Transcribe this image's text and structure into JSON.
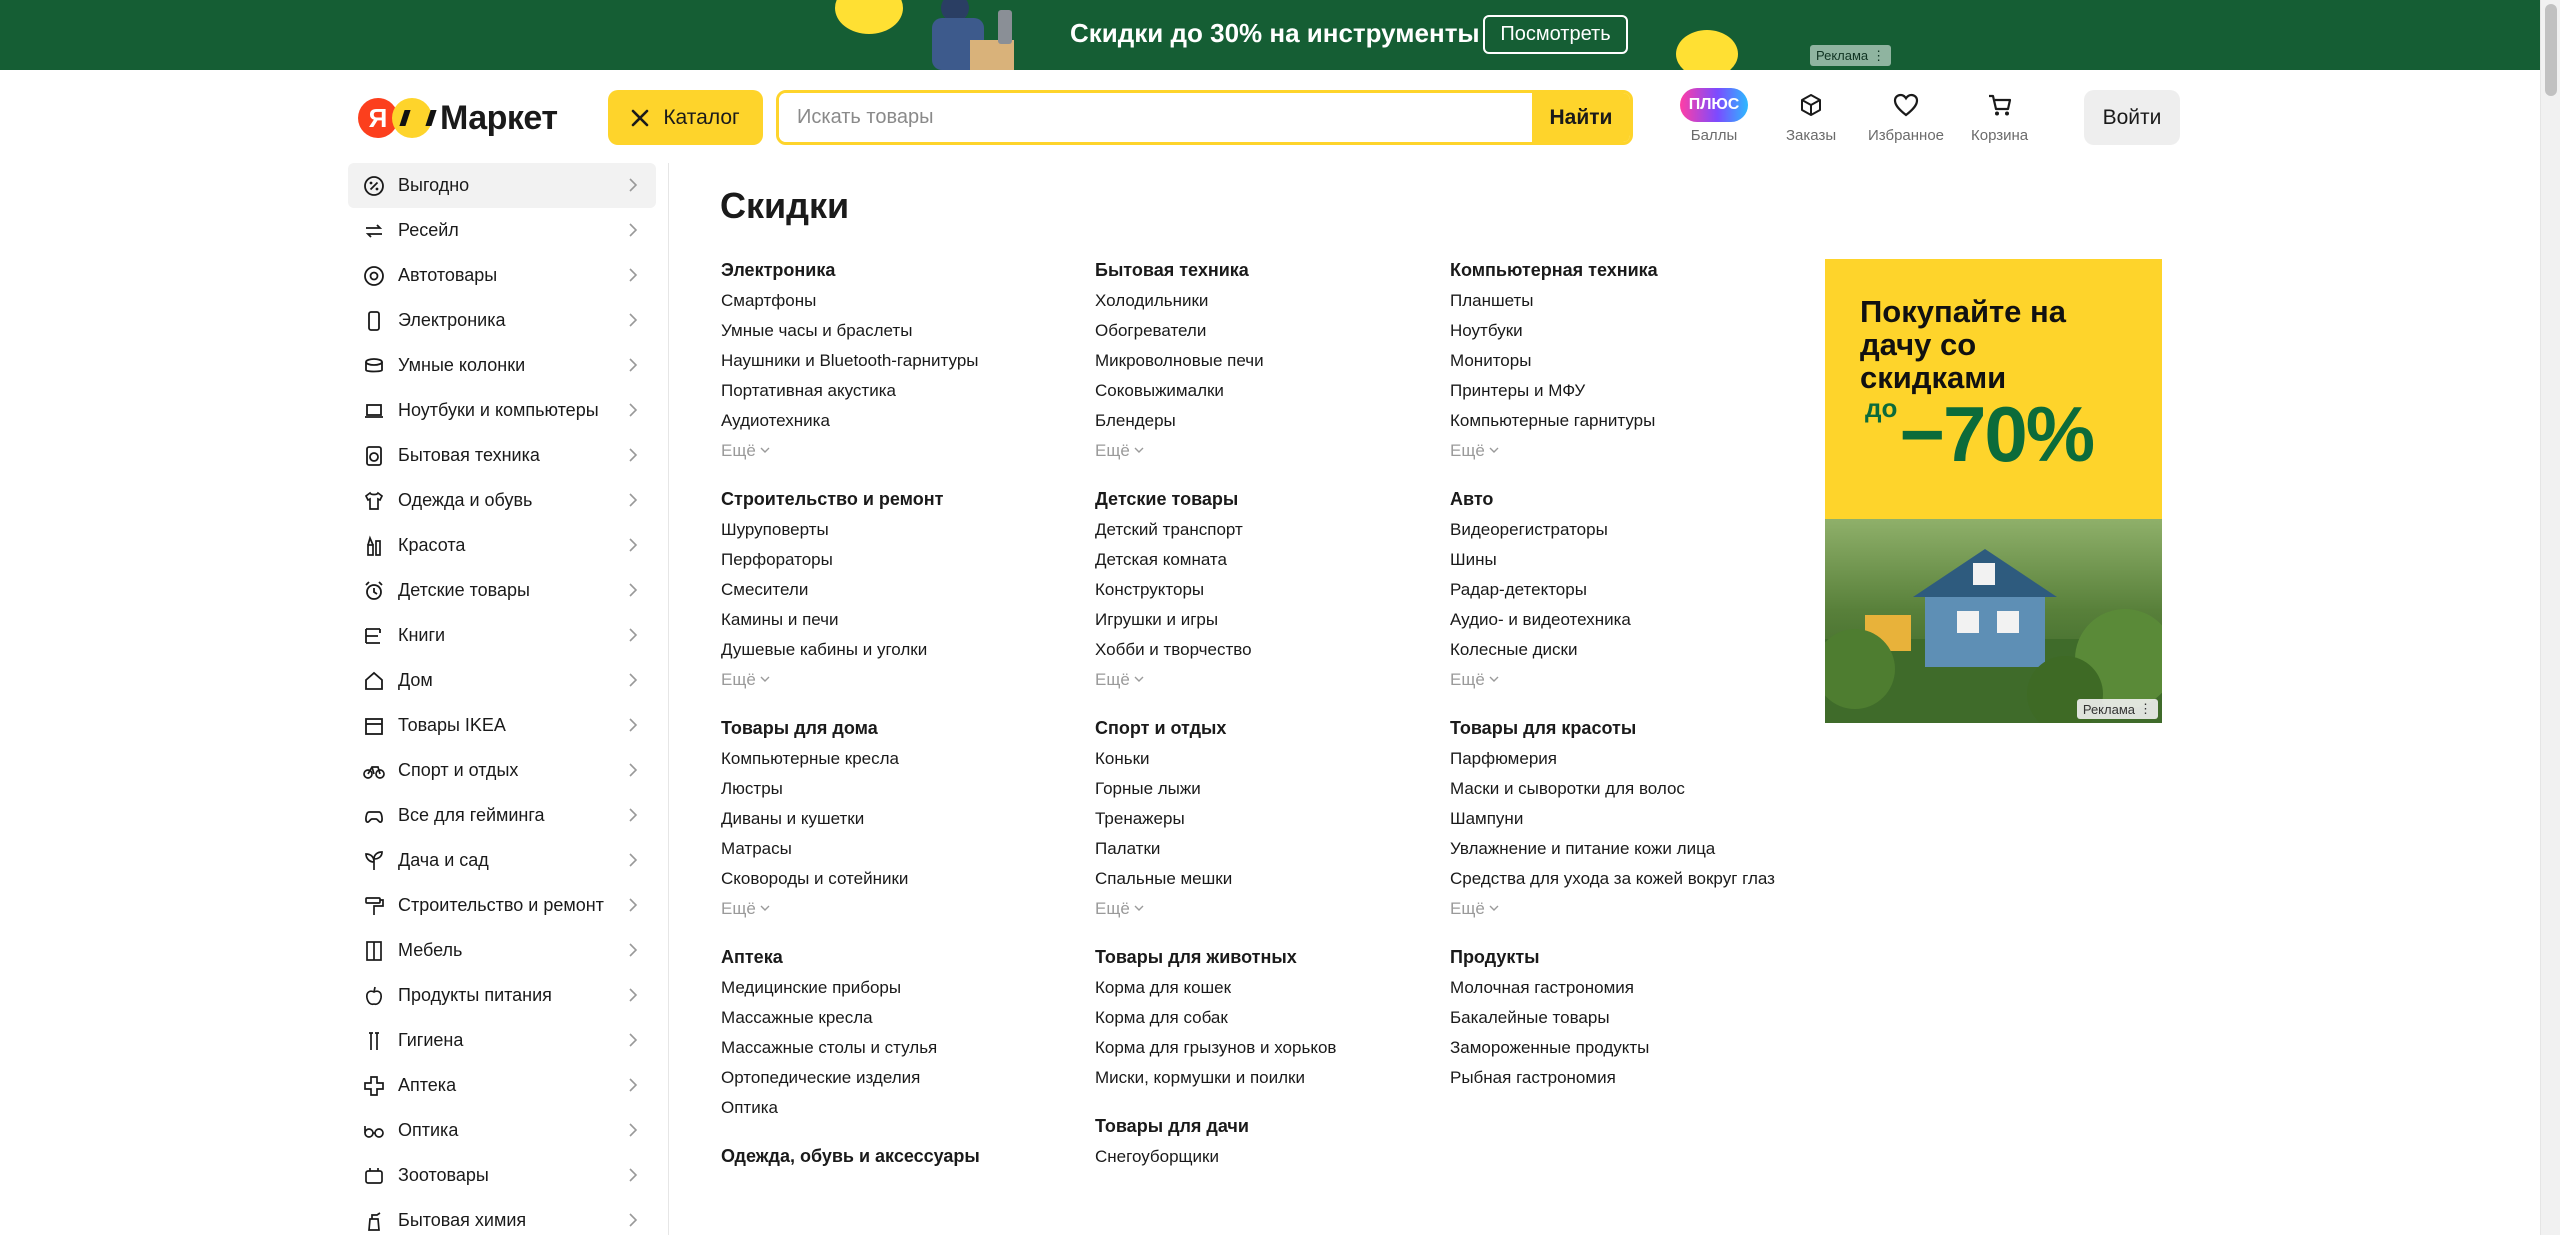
{
  "banner": {
    "text": "Скидки до 30% на инструменты",
    "button_label": "Посмотреть",
    "ad_label": "Реклама",
    "background": "#155e34"
  },
  "header": {
    "logo_letter": "Я",
    "logo_text": "Маркет",
    "catalog_label": "Каталог",
    "search_placeholder": "Искать товары",
    "search_button": "Найти",
    "plus_badge": "ПЛЮС",
    "nav": [
      {
        "label": "Баллы",
        "icon": "plus-points-icon"
      },
      {
        "label": "Заказы",
        "icon": "box-icon"
      },
      {
        "label": "Избранное",
        "icon": "heart-icon"
      },
      {
        "label": "Корзина",
        "icon": "cart-icon"
      }
    ],
    "login_label": "Войти",
    "accent": "#fed42b"
  },
  "sidebar": {
    "items": [
      {
        "label": "Выгодно",
        "icon": "percent-icon"
      },
      {
        "label": "Ресейл",
        "icon": "resale-icon"
      },
      {
        "label": "Автотовары",
        "icon": "wheel-icon"
      },
      {
        "label": "Электроника",
        "icon": "phone-icon"
      },
      {
        "label": "Умные колонки",
        "icon": "speaker-icon"
      },
      {
        "label": "Ноутбуки и компьютеры",
        "icon": "laptop-icon"
      },
      {
        "label": "Бытовая техника",
        "icon": "washer-icon"
      },
      {
        "label": "Одежда и обувь",
        "icon": "shirt-icon"
      },
      {
        "label": "Красота",
        "icon": "cosmetics-icon"
      },
      {
        "label": "Детские товары",
        "icon": "alarm-clock-icon"
      },
      {
        "label": "Книги",
        "icon": "books-icon"
      },
      {
        "label": "Дом",
        "icon": "house-icon"
      },
      {
        "label": "Товары IKEA",
        "icon": "store-icon"
      },
      {
        "label": "Спорт и отдых",
        "icon": "bicycle-icon"
      },
      {
        "label": "Все для гейминга",
        "icon": "gamepad-icon"
      },
      {
        "label": "Дача и сад",
        "icon": "plant-icon"
      },
      {
        "label": "Строительство и ремонт",
        "icon": "roller-icon"
      },
      {
        "label": "Мебель",
        "icon": "wardrobe-icon"
      },
      {
        "label": "Продукты питания",
        "icon": "apple-icon"
      },
      {
        "label": "Гигиена",
        "icon": "toothbrush-icon"
      },
      {
        "label": "Аптека",
        "icon": "medical-cross-icon"
      },
      {
        "label": "Оптика",
        "icon": "glasses-icon"
      },
      {
        "label": "Зоотовары",
        "icon": "pet-icon"
      },
      {
        "label": "Бытовая химия",
        "icon": "spray-bottle-icon"
      }
    ]
  },
  "main": {
    "title": "Скидки",
    "more_label": "Ещё",
    "columns": [
      [
        {
          "title": "Электроника",
          "links": [
            "Смартфоны",
            "Умные часы и браслеты",
            "Наушники и Bluetooth-гарнитуры",
            "Портативная акустика",
            "Аудиотехника"
          ],
          "more": true
        },
        {
          "title": "Строительство и ремонт",
          "links": [
            "Шуруповерты",
            "Перфораторы",
            "Смесители",
            "Камины и печи",
            "Душевые кабины и уголки"
          ],
          "more": true
        },
        {
          "title": "Товары для дома",
          "links": [
            "Компьютерные кресла",
            "Люстры",
            "Диваны и кушетки",
            "Матрасы",
            "Сковороды и сотейники"
          ],
          "more": true
        },
        {
          "title": "Аптека",
          "links": [
            "Медицинские приборы",
            "Массажные кресла",
            "Массажные столы и стулья",
            "Ортопедические изделия",
            "Оптика"
          ],
          "more": false
        },
        {
          "title": "Одежда, обувь и аксессуары",
          "links": [],
          "more": false
        }
      ],
      [
        {
          "title": "Бытовая техника",
          "links": [
            "Холодильники",
            "Обогреватели",
            "Микроволновые печи",
            "Соковыжималки",
            "Блендеры"
          ],
          "more": true
        },
        {
          "title": "Детские товары",
          "links": [
            "Детский транспорт",
            "Детская комната",
            "Конструкторы",
            "Игрушки и игры",
            "Хобби и творчество"
          ],
          "more": true
        },
        {
          "title": "Спорт и отдых",
          "links": [
            "Коньки",
            "Горные лыжи",
            "Тренажеры",
            "Палатки",
            "Спальные мешки"
          ],
          "more": true
        },
        {
          "title": "Товары для животных",
          "links": [
            "Корма для кошек",
            "Корма для собак",
            "Корма для грызунов и хорьков",
            "Миски, кормушки и поилки"
          ],
          "more": false
        },
        {
          "title": "Товары для дачи",
          "links": [
            "Снегоуборщики"
          ],
          "more": false
        }
      ],
      [
        {
          "title": "Компьютерная техника",
          "links": [
            "Планшеты",
            "Ноутбуки",
            "Мониторы",
            "Принтеры и МФУ",
            "Компьютерные гарнитуры"
          ],
          "more": true
        },
        {
          "title": "Авто",
          "links": [
            "Видеорегистраторы",
            "Шины",
            "Радар-детекторы",
            "Аудио- и видеотехника",
            "Колесные диски"
          ],
          "more": true
        },
        {
          "title": "Товары для красоты",
          "links": [
            "Парфюмерия",
            "Маски и сыворотки для волос",
            "Шампуни",
            "Увлажнение и питание кожи лица",
            "Средства для ухода за кожей вокруг глаз"
          ],
          "more": true
        },
        {
          "title": "Продукты",
          "links": [
            "Молочная гастрономия",
            "Бакалейные товары",
            "Замороженные продукты",
            "Рыбная гастрономия"
          ],
          "more": false
        }
      ]
    ]
  },
  "ad": {
    "headline": "Покупайте на дачу со скидками",
    "prefix": "до",
    "percent": "−70%",
    "label": "Реклама"
  }
}
